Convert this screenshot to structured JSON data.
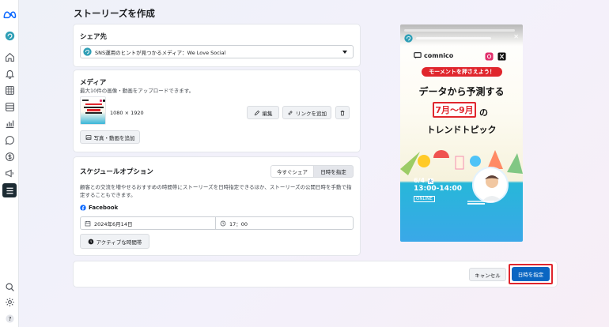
{
  "page": {
    "title": "ストーリーズを作成"
  },
  "share": {
    "heading": "シェア先",
    "selected": "SNS運用のヒントが見つかるメディア：We Love Social"
  },
  "media": {
    "heading": "メディア",
    "note": "最大10件の画像・動画をアップロードできます。",
    "dimensions": "1080 × 1920",
    "edit_label": "編集",
    "link_label": "リンクを追加",
    "add_label": "写真・動画を追加"
  },
  "schedule": {
    "heading": "スケジュールオプション",
    "tab_now": "今すぐシェア",
    "tab_schedule": "日時を指定",
    "desc": "顧客との交流を増やせるおすすめの時間帯にストーリーズを日時指定できるほか、ストーリーズの公開日時を手動で指定することもできます。",
    "platform": "Facebook",
    "date": "2024年6月14日",
    "time": "17：00",
    "active_times": "アクティブな時間帯"
  },
  "footer": {
    "cancel": "キャンセル",
    "schedule": "日時を指定"
  },
  "preview": {
    "brand": "comnico",
    "headline1": "モーメントを押さえよう！",
    "headline2": "データから予測する",
    "headline3": "7月～9月",
    "headline3b": "の",
    "headline4": "トレンドトピック",
    "date": "6/4",
    "date_day": "火",
    "time": "13:00-14:00",
    "online": "ONLINE"
  },
  "colors": {
    "primary": "#0a66c2",
    "highlight": "#e0262d",
    "preview_blue": "#3aa8e8"
  }
}
